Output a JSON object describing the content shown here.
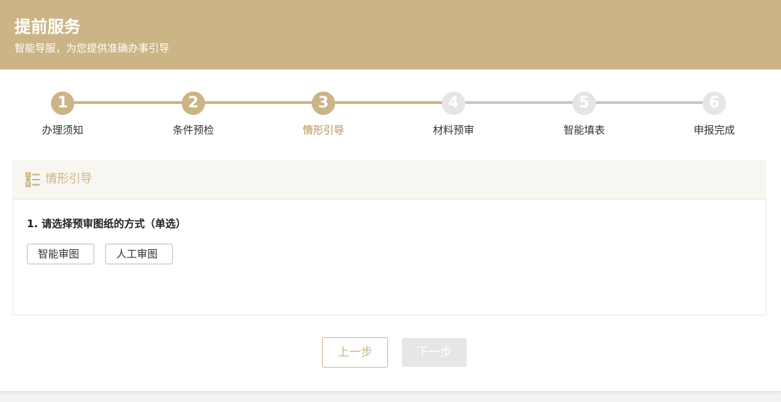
{
  "header": {
    "title": "提前服务",
    "subtitle": "智能导服，为您提供准确办事引导"
  },
  "colors": {
    "brand": "#cbb485",
    "inactive_step": "#e5e5e5",
    "inactive_line": "#c8c8c8",
    "disabled_button": "#e6e6e6"
  },
  "stepper": {
    "current_step": 3,
    "steps": [
      {
        "number": "1",
        "label": "办理须知",
        "state": "done"
      },
      {
        "number": "2",
        "label": "条件预检",
        "state": "done"
      },
      {
        "number": "3",
        "label": "情形引导",
        "state": "active"
      },
      {
        "number": "4",
        "label": "材料预审",
        "state": "todo"
      },
      {
        "number": "5",
        "label": "智能填表",
        "state": "todo"
      },
      {
        "number": "6",
        "label": "申报完成",
        "state": "todo"
      }
    ]
  },
  "panel": {
    "title": "情形引导",
    "icon": "checklist-icon",
    "question": "1. 请选择预审图纸的方式（单选）",
    "options": [
      "智能审图",
      "人工审图"
    ]
  },
  "footer": {
    "prev_label": "上一步",
    "next_label": "下一步"
  }
}
